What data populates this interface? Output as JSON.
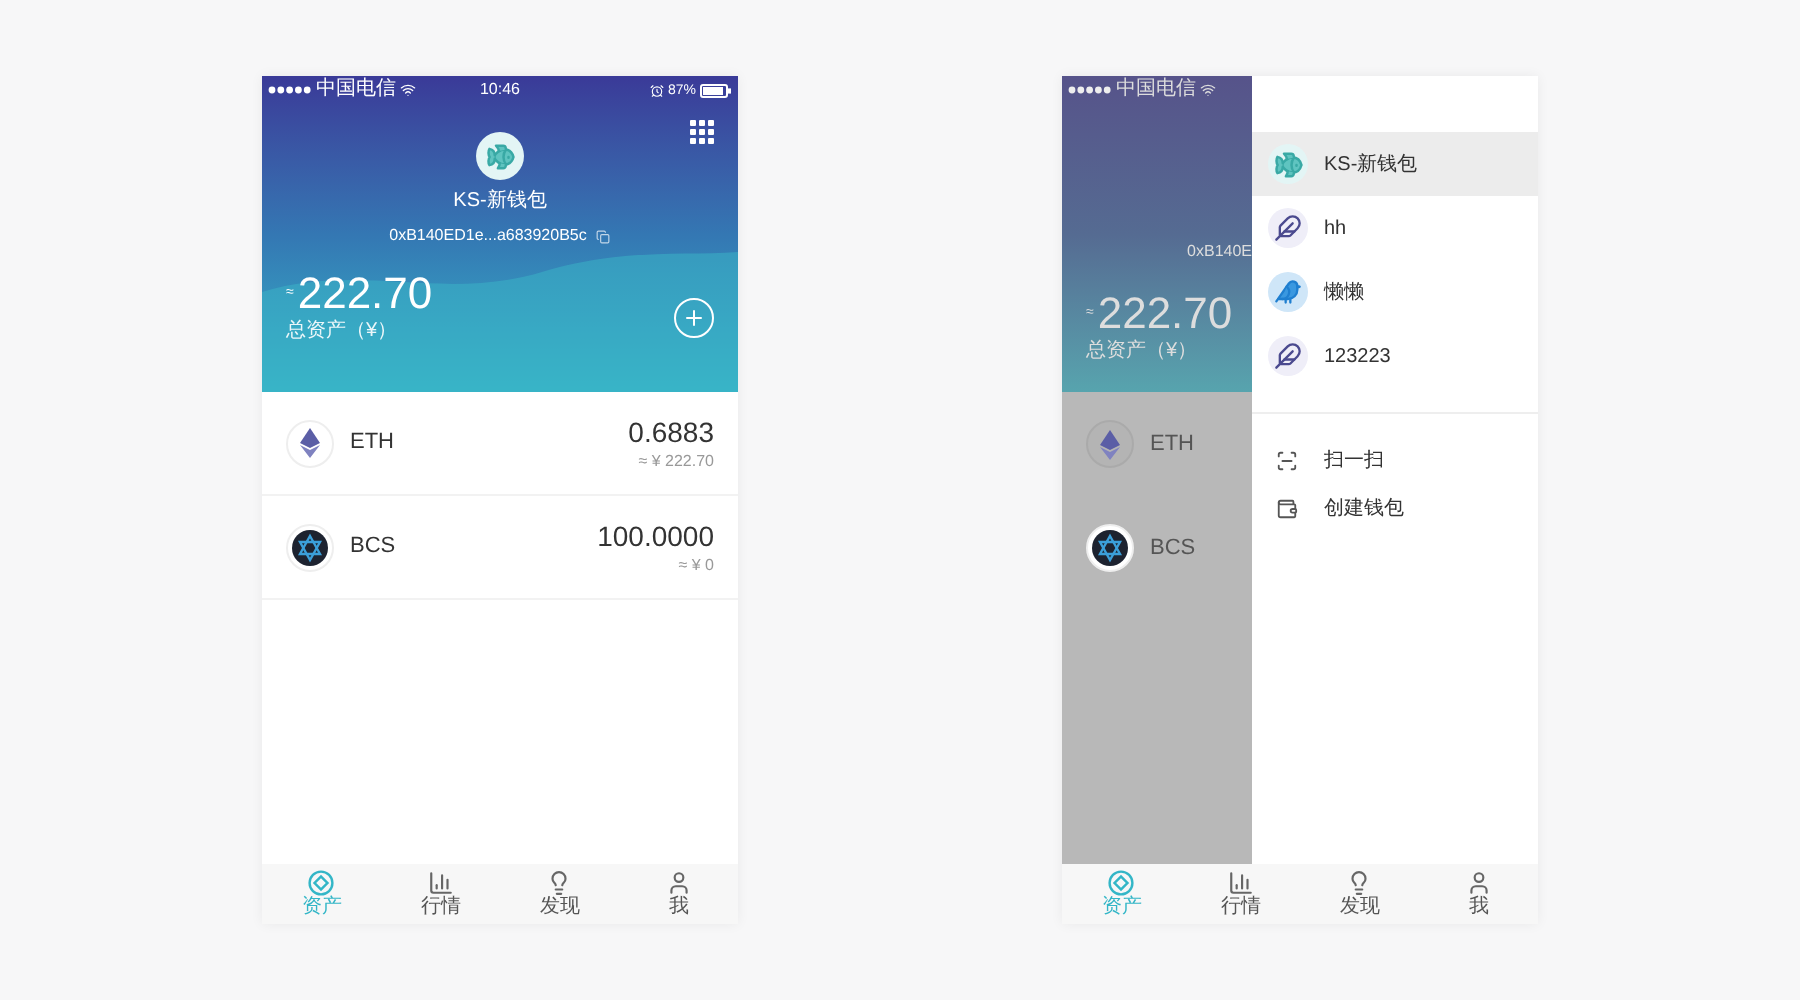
{
  "home": {
    "status_bar": {
      "carrier": "中国电信",
      "time": "10:46",
      "battery": "87%"
    },
    "wallet": {
      "name": "KS-新钱包",
      "address": "0xB140ED1e...a683920B5c"
    },
    "total": {
      "approx": "≈",
      "amount": "222.70",
      "label": "总资产（¥）"
    },
    "assets": [
      {
        "kind": "eth",
        "symbol": "ETH",
        "amount": "0.6883",
        "value": "≈ ¥ 222.70"
      },
      {
        "kind": "bcs",
        "symbol": "BCS",
        "amount": "100.0000",
        "value": "≈ ¥ 0"
      }
    ],
    "tabs": [
      {
        "kind": "assets",
        "label": "资产",
        "selected": true
      },
      {
        "kind": "market",
        "label": "行情",
        "selected": false
      },
      {
        "kind": "discover",
        "label": "发现",
        "selected": false
      },
      {
        "kind": "me",
        "label": "我",
        "selected": false
      }
    ]
  },
  "drawer_screen": {
    "status_bar": {
      "carrier": "中国电信"
    },
    "background": {
      "address": "0xB140E",
      "approx": "≈",
      "amount": "222.70",
      "label": "总资产（¥）",
      "assets": [
        {
          "kind": "eth",
          "symbol": "ETH"
        },
        {
          "kind": "bcs",
          "symbol": "BCS"
        }
      ]
    },
    "wallets": [
      {
        "kind": "fish",
        "name": "KS-新钱包",
        "selected": true
      },
      {
        "kind": "feather",
        "name": "hh",
        "selected": false
      },
      {
        "kind": "bird",
        "name": "懒懒",
        "selected": false
      },
      {
        "kind": "feather",
        "name": "123223",
        "selected": false
      }
    ],
    "actions": [
      {
        "kind": "scan",
        "label": "扫一扫"
      },
      {
        "kind": "wallet",
        "label": "创建钱包"
      }
    ],
    "tabs": [
      {
        "kind": "assets",
        "label": "资产",
        "selected": true
      },
      {
        "kind": "market",
        "label": "行情",
        "selected": false
      },
      {
        "kind": "discover",
        "label": "发现",
        "selected": false
      },
      {
        "kind": "me",
        "label": "我",
        "selected": false
      }
    ]
  }
}
